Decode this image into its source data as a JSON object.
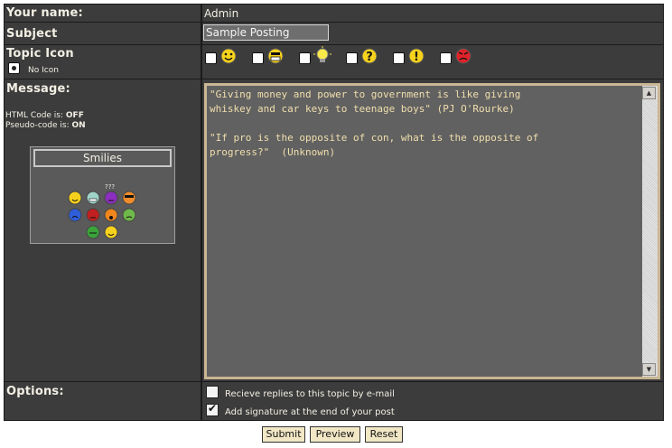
{
  "form": {
    "name_label": "Your name:",
    "name_value": "Admin",
    "subject_label": "Subject",
    "subject_value": "Sample Posting",
    "topic_icon_label": "Topic Icon",
    "no_icon_label": "No Icon",
    "icons": [
      "smile-icon",
      "grin-icon",
      "lightbulb-icon",
      "question-icon",
      "exclamation-icon",
      "angry-icon"
    ],
    "message_label": "Message:",
    "html_code_label": "HTML Code is:",
    "html_code_value": "OFF",
    "pseudo_code_label": "Pseudo-code is:",
    "pseudo_code_value": "ON",
    "message_text": "\"Giving money and power to government is like giving\nwhiskey and car keys to teenage boys\" (PJ O'Rourke)\n\n\"If pro is the opposite of con, what is the opposite of\nprogress?\"  (Unknown)",
    "smilies_title": "Smilies",
    "smilies_caption": "???",
    "options_label": "Options:",
    "options": [
      {
        "label": "Recieve replies to this topic by e-mail",
        "checked": false
      },
      {
        "label": "Add signature at the end of your post",
        "checked": true
      }
    ]
  },
  "buttons": {
    "submit": "Submit",
    "preview": "Preview",
    "reset": "Reset"
  },
  "colors": {
    "panel_bg": "#3c3c3c",
    "border_bg": "#1a1a1a",
    "textarea_bg": "#616161",
    "textarea_text": "#f1dfad",
    "button_bg": "#f1e7c5"
  }
}
